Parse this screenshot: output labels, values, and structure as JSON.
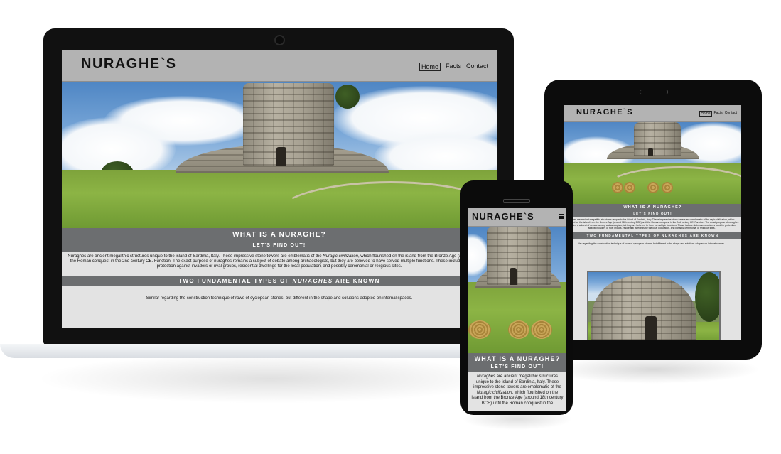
{
  "site": {
    "brand": "NURAGHE`S",
    "nav": [
      {
        "label": "Home",
        "active": true
      },
      {
        "label": "Facts",
        "active": false
      },
      {
        "label": "Contact",
        "active": false
      }
    ]
  },
  "section1": {
    "heading": "WHAT IS A NURAGHE?",
    "subheading": "LET'S FIND OUT!",
    "desktop_paragraph": {
      "before": "Nuraghes are ancient megalithic structures unique to the island of Sardinia, Italy. These impressive stone towers are emblematic of the ",
      "emph": "Nuragic civilization",
      "after": ", which flourished on the island from the Bronze Age (around 18th until the Roman conquest in the 2nd century CE. Function: The exact purpose of nuraghes remains a subject of debate among archaeologists, but they are believed to have served multiple functions. These include defe used for protection against invaders or rival groups, residential dwellings for the local population, and possibly ceremonial or religious sites."
    },
    "tablet_paragraph": "raghes are ancient megalithic structures unique to the island of Sardinia, Italy. These impressive stone towers are emblematic of the ragic civilization, which flourished on the island from the Bronze Age (around 18th century BCE) until the Roman conquest in the 2nd century CE. Function: The exact purpose of nuraghes remains a subject of debate among archaeologists, but they are believed to have ve multiple functions. These include defensive structures used for protection against invaders or rival groups, residential dwellings for the local population, and possibly ceremonial or religious sites.",
    "mobile_paragraph": {
      "emph1": "Nuraghes",
      "mid": " are ancient megalithic structures unique to the island of Sardinia, Italy. These impressive stone towers are emblematic of the ",
      "emph2": "Nuragic civilization",
      "after": ", which flourished on the island from the Bronze Age (around 18th century BCE) until the Roman conquest in the"
    }
  },
  "section2": {
    "heading_before": "TWO FUNDAMENTAL TYPES OF ",
    "heading_emph": "NURAGHES",
    "heading_after": " ARE KNOWN",
    "tablet_heading": "TWO FUNDAMENTAL TYPES OF NURAGHES ARE KNOWN",
    "paragraph": "Similar regarding the construction technique of rows of cyclopean stones, but different in the shape and solutions adopted on internal spaces.",
    "tablet_paragraph": "ilar regarding the construction technique of rows of cyclopean stones, but different in the shape and solutions adopted on internal spaces."
  },
  "colors": {
    "header_bg": "#b3b3b3",
    "band_bg": "#6c6e70",
    "page_bg": "#e3e3e3",
    "device_frame": "#111111"
  },
  "icons": [
    "hamburger-menu-icon",
    "camera-icon",
    "speaker-icon"
  ]
}
